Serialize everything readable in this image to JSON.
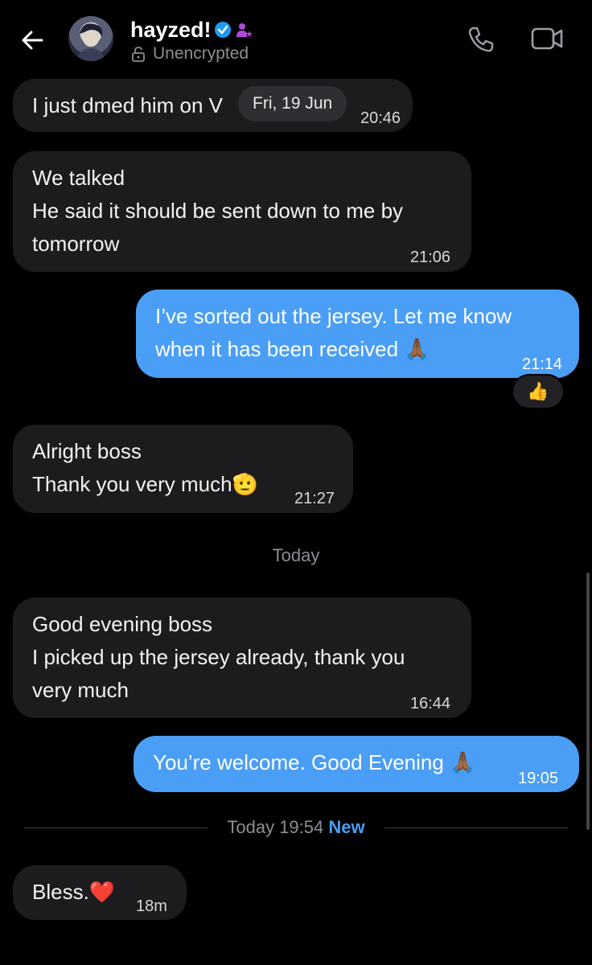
{
  "header": {
    "contact_name": "hayzed!",
    "encryption_status": "Unencrypted"
  },
  "date_pill": "Fri, 19 Jun",
  "messages": [
    {
      "text_lines": [
        "I just dmed him on V"
      ],
      "time": "20:46"
    },
    {
      "text_lines": [
        "We talked",
        "He said it should be sent down to me by",
        "tomorrow"
      ],
      "time": "21:06"
    },
    {
      "text_lines": [
        "I’ve sorted out the jersey. Let me know",
        "when it has been received"
      ],
      "time": "21:14"
    },
    {
      "text_lines": [
        "Alright boss",
        "Thank you very much"
      ],
      "time": "21:27"
    },
    {
      "text_lines": [
        "Good evening boss",
        "I picked up the jersey already, thank you",
        "very much"
      ],
      "time": "16:44"
    },
    {
      "text_lines": [
        "You’re welcome. Good Evening"
      ],
      "time": "19:05"
    },
    {
      "text_lines": [
        "Bless."
      ],
      "time": "18m"
    }
  ],
  "reaction": "👍",
  "day_separator": "Today",
  "new_divider": {
    "time_text": "Today 19:54",
    "badge": "New"
  },
  "icons": {
    "back": "arrow-left-icon",
    "verified": "verified-badge-icon",
    "affiliate": "person-badge-icon",
    "lock": "lock-icon",
    "call": "phone-icon",
    "video": "video-camera-icon"
  },
  "colors": {
    "outgoing": "#4a9ef5",
    "incoming": "#1c1c1f",
    "background": "#000000"
  }
}
